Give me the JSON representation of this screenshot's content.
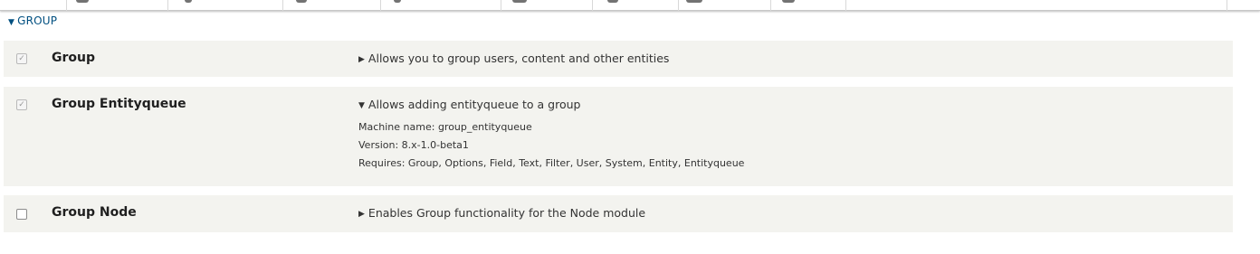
{
  "toolbar": {
    "icons": [
      "manage-icon",
      "shortcuts-icon",
      "content-icon",
      "structure-icon",
      "appearance-icon",
      "extend-icon",
      "config-icon",
      "people-icon",
      "reports-icon",
      "help-icon"
    ]
  },
  "group": {
    "toggle_glyph": "▼",
    "title": "GROUP"
  },
  "modules": [
    {
      "checkbox_mark": "✓",
      "name": "Group",
      "toggle_glyph": "▶",
      "description": "Allows you to group users, content and other entities"
    },
    {
      "checkbox_mark": "✓",
      "name": "Group Entityqueue",
      "toggle_glyph": "▼",
      "description": "Allows adding entityqueue to a group",
      "machine_name": "Machine name: group_entityqueue",
      "version": "Version: 8.x-1.0-beta1",
      "requires": "Requires: Group, Options, Field, Text, Filter, User, System, Entity, Entityqueue"
    },
    {
      "checkbox_mark": "",
      "name": "Group Node",
      "toggle_glyph": "▶",
      "description": "Enables Group functionality for the Node module"
    }
  ]
}
